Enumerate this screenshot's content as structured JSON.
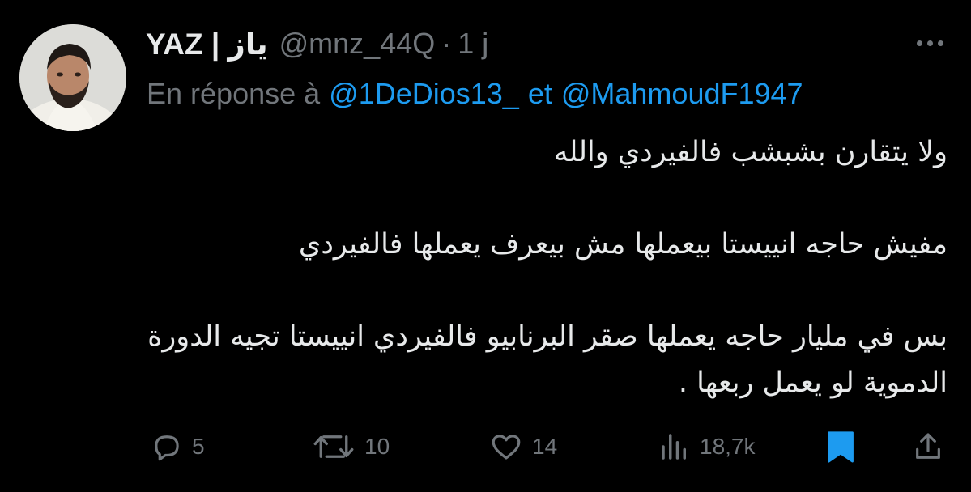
{
  "tweet": {
    "author": {
      "display_name": "YAZ | ياز",
      "handle": "@mnz_44Q",
      "separator": "·",
      "time": "1 j",
      "avatar": "avatar-photo"
    },
    "reply_to": {
      "prefix": "En réponse à",
      "mention_1": "@1DeDios13_",
      "connector": "et",
      "mention_2": "@MahmoudF1947"
    },
    "text": {
      "line_1": "ولا يتقارن بشبشب فالفيردي والله",
      "line_2": "مفيش حاجه انييستا بيعملها مش بيعرف يعملها فالفيردي",
      "line_3": "بس في مليار حاجه يعملها صقر البرنابيو فالفيردي انييستا تجيه الدورة الدموية لو يعمل ربعها ."
    },
    "actions": {
      "reply": {
        "icon": "reply-icon",
        "count": "5"
      },
      "retweet": {
        "icon": "retweet-icon",
        "count": "10"
      },
      "like": {
        "icon": "heart-icon",
        "count": "14"
      },
      "views": {
        "icon": "views-icon",
        "count": "18,7k"
      },
      "bookmark": {
        "icon": "bookmark-icon",
        "active": true
      },
      "share": {
        "icon": "share-icon"
      }
    },
    "more_icon": "more-icon"
  },
  "colors": {
    "background": "#000000",
    "text_primary": "#e7e9ea",
    "text_secondary": "#71767b",
    "accent": "#1d9bf0"
  }
}
